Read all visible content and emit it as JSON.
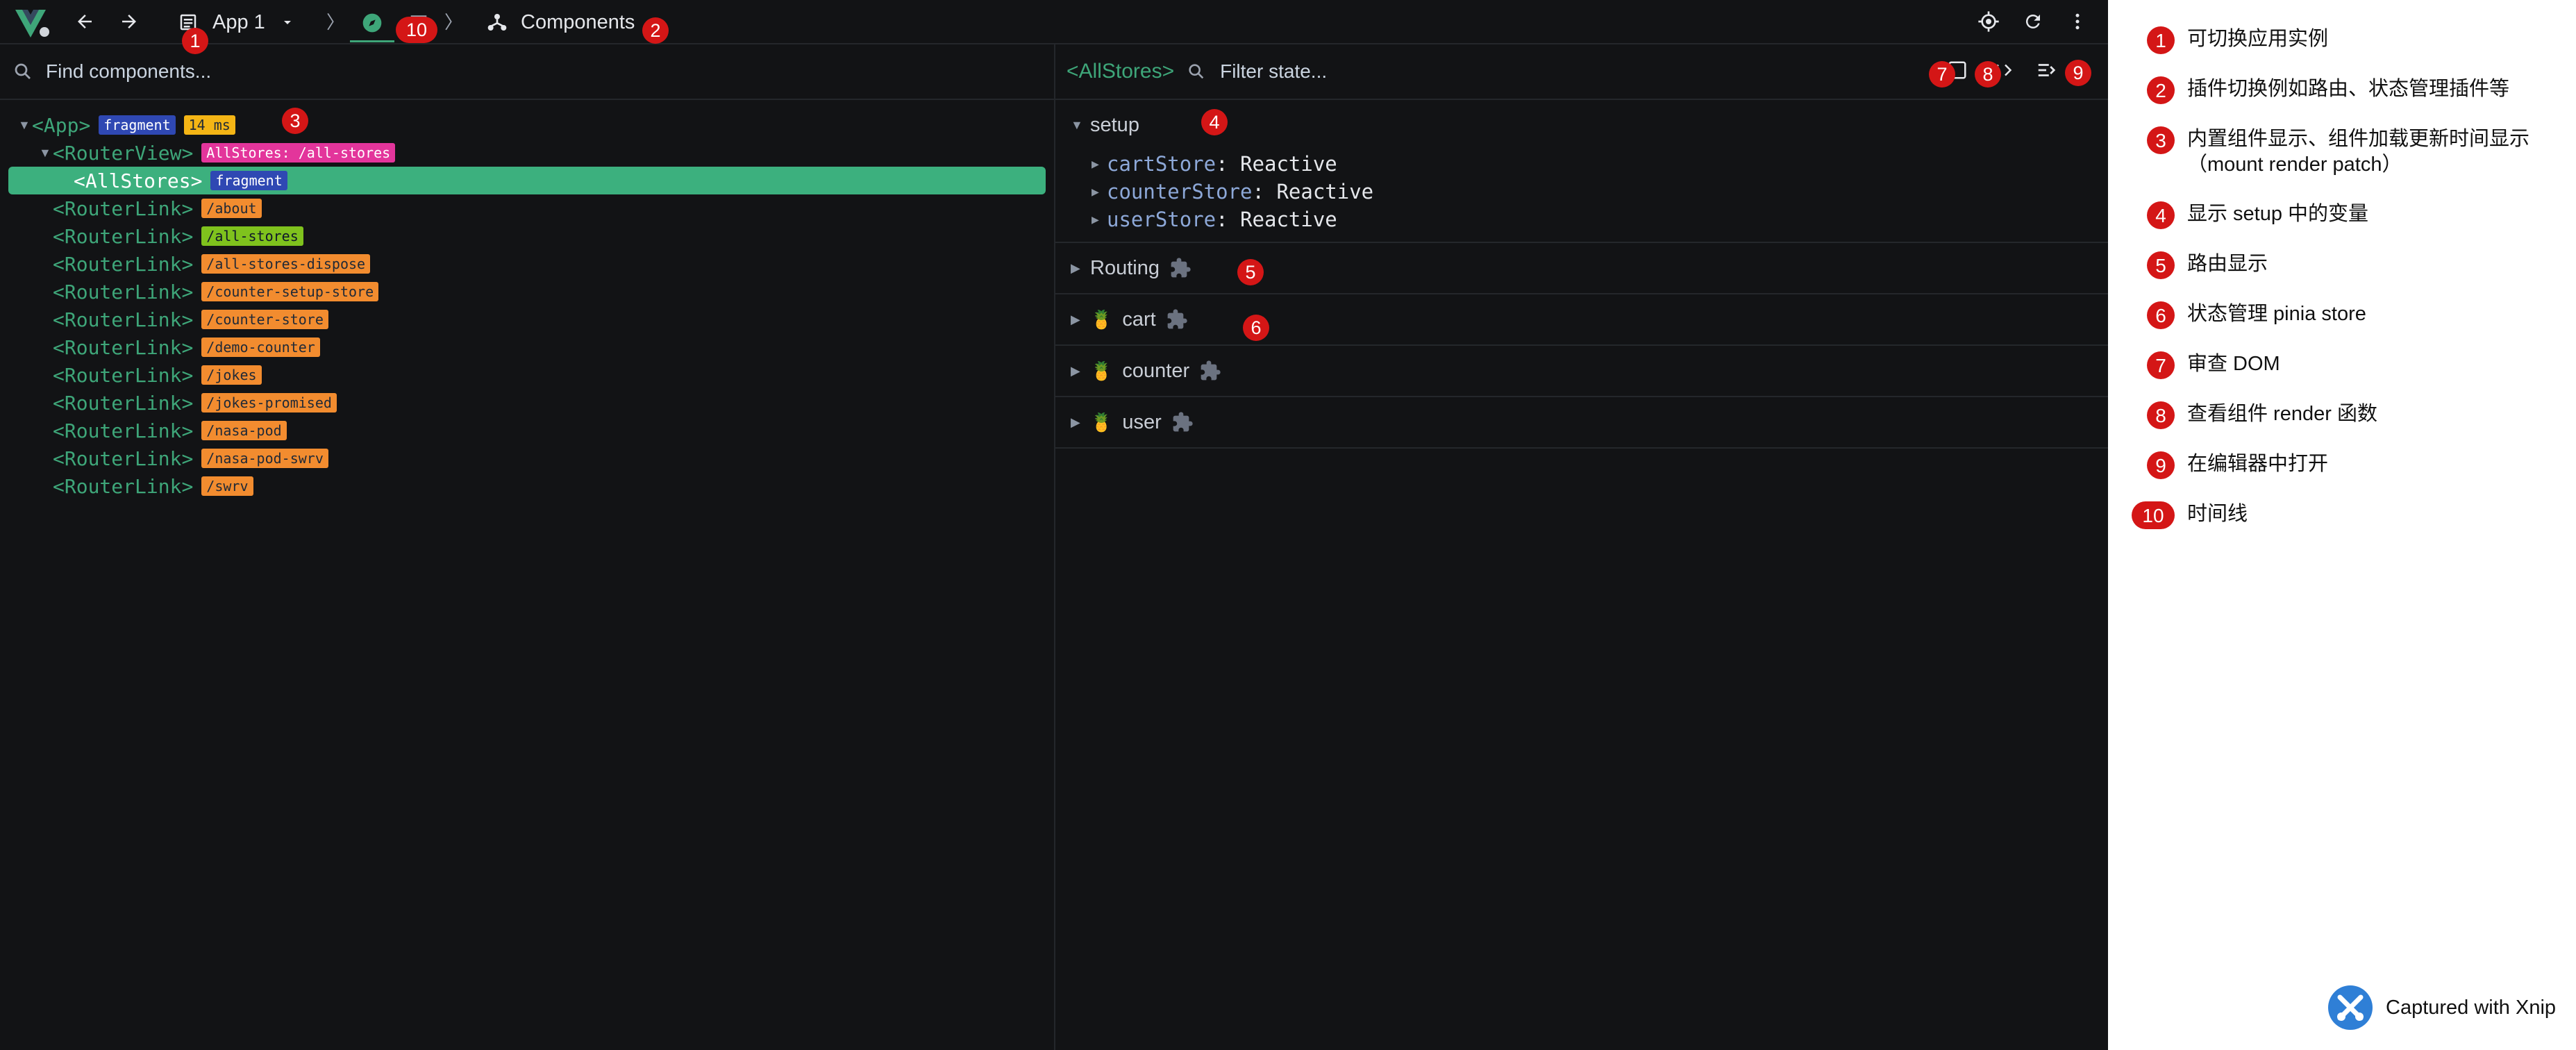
{
  "toolbar": {
    "app_selector": "App 1",
    "breadcrumb_current": "Components"
  },
  "components": {
    "search_placeholder": "Find components...",
    "tree": [
      {
        "tag": "App",
        "badges": [
          {
            "text": "fragment",
            "kind": "frag"
          },
          {
            "text": "14 ms",
            "kind": "time"
          }
        ],
        "depth": 0,
        "arrow": "open",
        "selected": false
      },
      {
        "tag": "RouterView",
        "badges": [
          {
            "text": "AllStores: /all-stores",
            "kind": "view"
          }
        ],
        "depth": 1,
        "arrow": "open",
        "selected": false
      },
      {
        "tag": "AllStores",
        "badges": [
          {
            "text": "fragment",
            "kind": "frag"
          }
        ],
        "depth": 2,
        "arrow": "none",
        "selected": true
      },
      {
        "tag": "RouterLink",
        "badges": [
          {
            "text": "/about",
            "kind": "link"
          }
        ],
        "depth": 1,
        "arrow": "none",
        "selected": false
      },
      {
        "tag": "RouterLink",
        "badges": [
          {
            "text": "/all-stores",
            "kind": "active"
          }
        ],
        "depth": 1,
        "arrow": "none",
        "selected": false
      },
      {
        "tag": "RouterLink",
        "badges": [
          {
            "text": "/all-stores-dispose",
            "kind": "link"
          }
        ],
        "depth": 1,
        "arrow": "none",
        "selected": false
      },
      {
        "tag": "RouterLink",
        "badges": [
          {
            "text": "/counter-setup-store",
            "kind": "link"
          }
        ],
        "depth": 1,
        "arrow": "none",
        "selected": false
      },
      {
        "tag": "RouterLink",
        "badges": [
          {
            "text": "/counter-store",
            "kind": "link"
          }
        ],
        "depth": 1,
        "arrow": "none",
        "selected": false
      },
      {
        "tag": "RouterLink",
        "badges": [
          {
            "text": "/demo-counter",
            "kind": "link"
          }
        ],
        "depth": 1,
        "arrow": "none",
        "selected": false
      },
      {
        "tag": "RouterLink",
        "badges": [
          {
            "text": "/jokes",
            "kind": "link"
          }
        ],
        "depth": 1,
        "arrow": "none",
        "selected": false
      },
      {
        "tag": "RouterLink",
        "badges": [
          {
            "text": "/jokes-promised",
            "kind": "link"
          }
        ],
        "depth": 1,
        "arrow": "none",
        "selected": false
      },
      {
        "tag": "RouterLink",
        "badges": [
          {
            "text": "/nasa-pod",
            "kind": "link"
          }
        ],
        "depth": 1,
        "arrow": "none",
        "selected": false
      },
      {
        "tag": "RouterLink",
        "badges": [
          {
            "text": "/nasa-pod-swrv",
            "kind": "link"
          }
        ],
        "depth": 1,
        "arrow": "none",
        "selected": false
      },
      {
        "tag": "RouterLink",
        "badges": [
          {
            "text": "/swrv",
            "kind": "link"
          }
        ],
        "depth": 1,
        "arrow": "none",
        "selected": false
      }
    ]
  },
  "inspector": {
    "selected_component": "<AllStores>",
    "filter_placeholder": "Filter state...",
    "setup": {
      "title": "setup",
      "rows": [
        {
          "key": "cartStore",
          "value": "Reactive"
        },
        {
          "key": "counterStore",
          "value": "Reactive"
        },
        {
          "key": "userStore",
          "value": "Reactive"
        }
      ]
    },
    "sections": [
      {
        "title": "Routing",
        "store": false
      },
      {
        "title": "cart",
        "store": true
      },
      {
        "title": "counter",
        "store": true
      },
      {
        "title": "user",
        "store": true
      }
    ]
  },
  "markers": [
    "1",
    "2",
    "3",
    "4",
    "5",
    "6",
    "7",
    "8",
    "9",
    "10"
  ],
  "legend": [
    {
      "num": "1",
      "text": "可切换应用实例"
    },
    {
      "num": "2",
      "text": "插件切换例如路由、状态管理插件等"
    },
    {
      "num": "3",
      "text": "内置组件显示、组件加载更新时间显示（mount render patch）"
    },
    {
      "num": "4",
      "text": "显示 setup 中的变量"
    },
    {
      "num": "5",
      "text": "路由显示"
    },
    {
      "num": "6",
      "text": "状态管理 pinia store"
    },
    {
      "num": "7",
      "text": "审查 DOM"
    },
    {
      "num": "8",
      "text": "查看组件 render 函数"
    },
    {
      "num": "9",
      "text": "在编辑器中打开"
    },
    {
      "num": "10",
      "text": "时间线"
    }
  ],
  "watermark": "Captured with Xnip",
  "colors": {
    "background": "#121315",
    "vue_green": "#3ea679",
    "selected_row": "#3cb07e",
    "marker_red": "#d41616",
    "badge_fragment": "#2f48b3",
    "badge_time": "#f4b515",
    "badge_routerview": "#e3359b",
    "badge_routerlink": "#f28c2f",
    "badge_active_link": "#7fc21d"
  }
}
